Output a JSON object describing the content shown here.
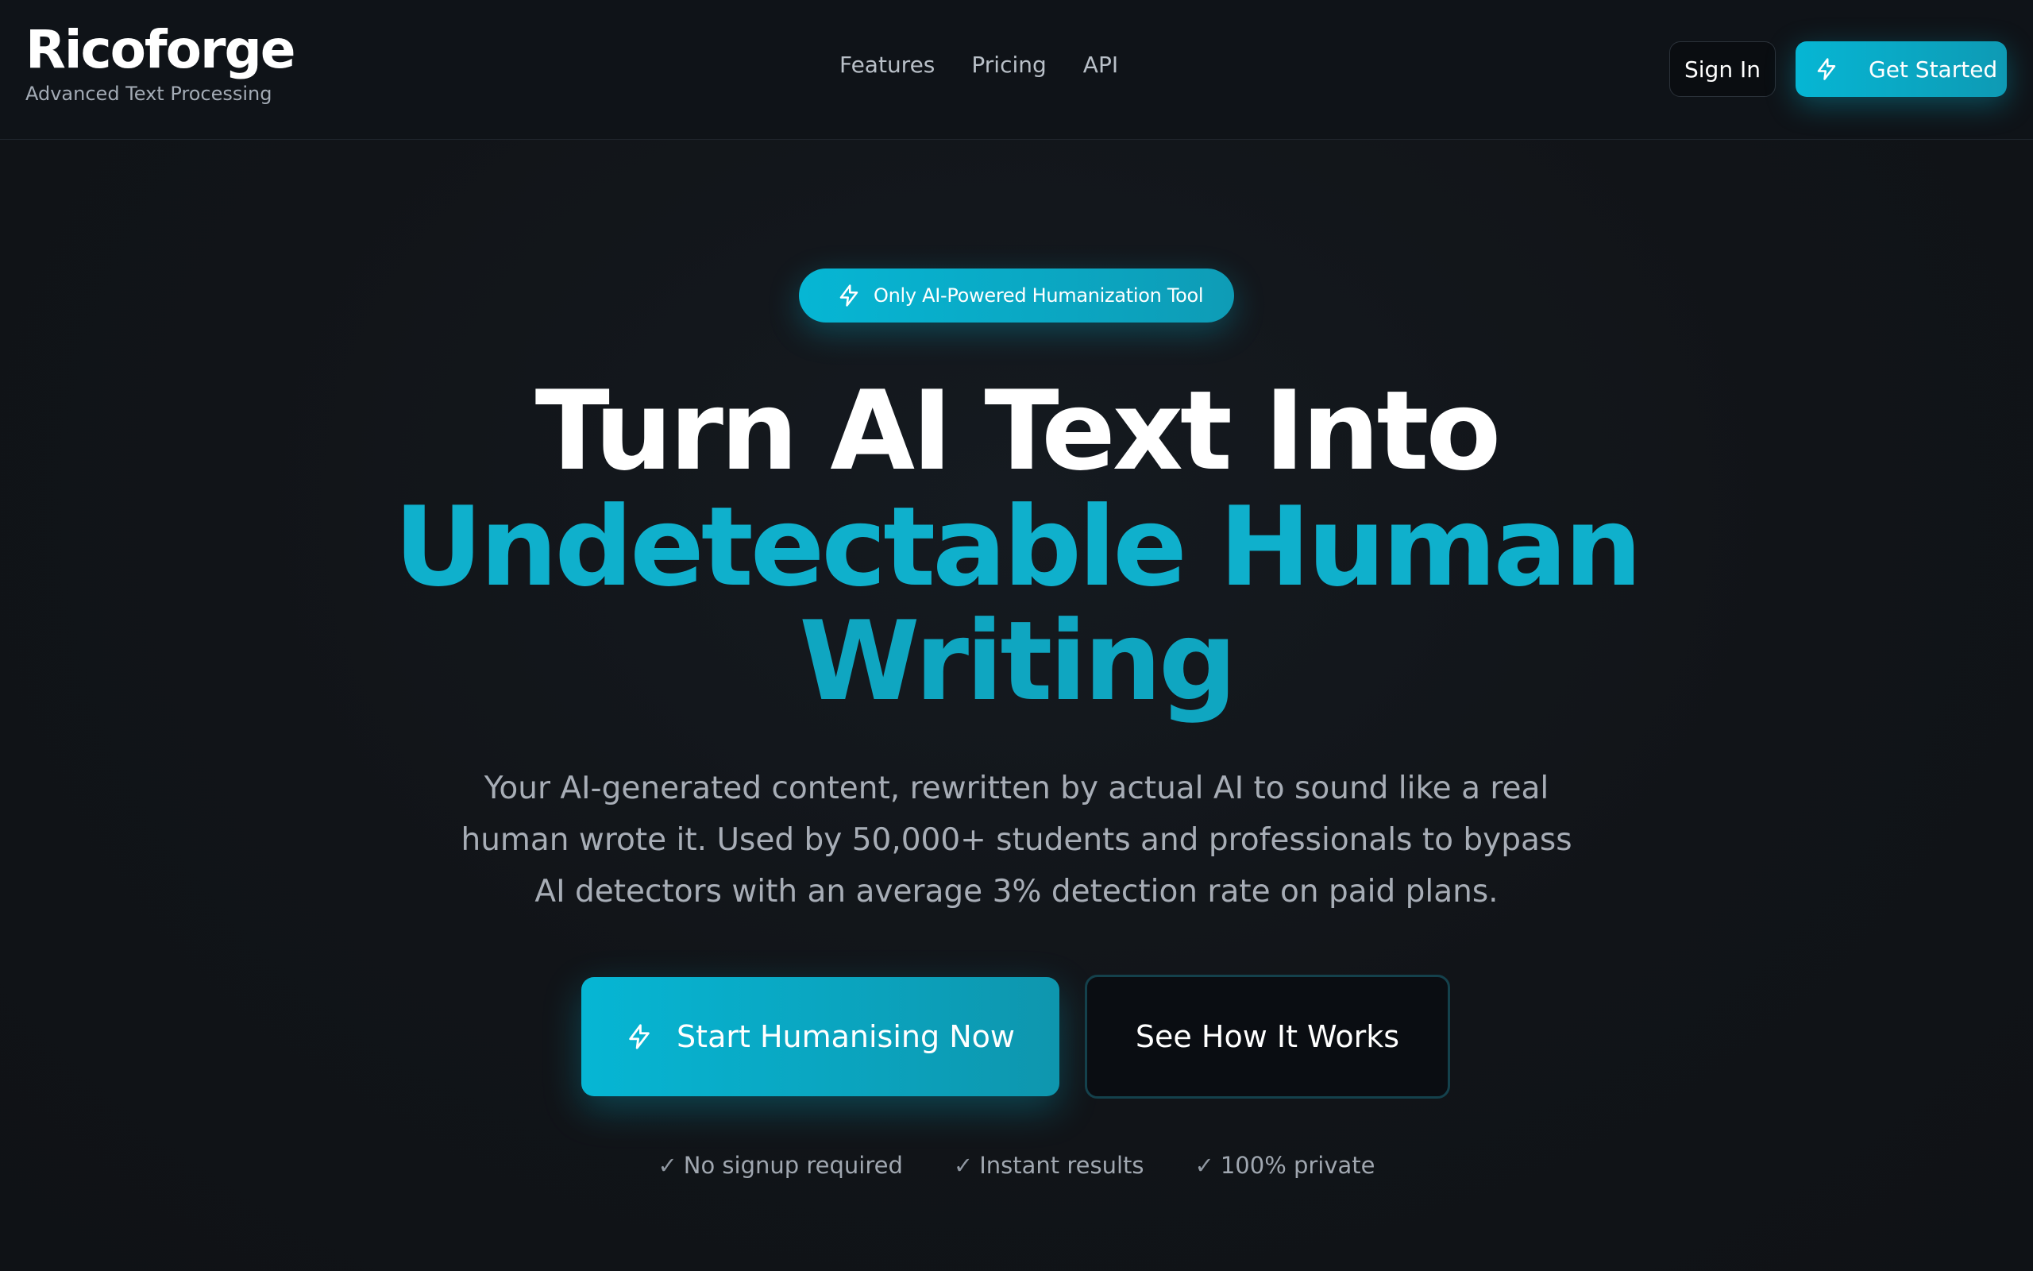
{
  "header": {
    "brand_name": "Ricoforge",
    "brand_tagline": "Advanced Text Processing",
    "nav": [
      {
        "label": "Features"
      },
      {
        "label": "Pricing"
      },
      {
        "label": "API"
      }
    ],
    "signin_label": "Sign In",
    "get_started_label": "Get Started",
    "get_started_icon": "lightning-icon"
  },
  "hero": {
    "badge_label": "Only AI-Powered Humanization Tool",
    "badge_icon": "lightning-icon",
    "headline_line1": "Turn AI Text Into",
    "headline_line2": "Undetectable Human",
    "headline_line3": "Writing",
    "subtext_line1": "Your AI-generated content, rewritten by actual AI to sound like a real",
    "subtext_line2": "human wrote it. Used by 50,000+ students and professionals to bypass",
    "subtext_line3": "AI detectors with an average 3% detection rate on paid plans.",
    "cta_primary_label": "Start Humanising Now",
    "cta_primary_icon": "lightning-icon",
    "cta_secondary_label": "See How It Works",
    "features": [
      {
        "check": "✓",
        "label": "No signup required"
      },
      {
        "check": "✓",
        "label": "Instant results"
      },
      {
        "check": "✓",
        "label": "100% private"
      }
    ]
  },
  "colors": {
    "accent": "#06b6d4",
    "background": "#111418",
    "header_bg": "#0f1318",
    "muted_text": "#a7adb6"
  }
}
